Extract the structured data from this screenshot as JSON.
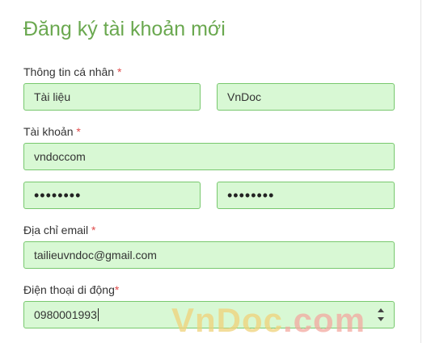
{
  "form": {
    "title": "Đăng ký tài khoản mới",
    "personal": {
      "label": "Thông tin cá nhân",
      "required_mark": "*",
      "first_name": "Tài liệu",
      "last_name": "VnDoc"
    },
    "account": {
      "label": "Tài khoản",
      "required_mark": "*",
      "username": "vndoccom",
      "password": "••••••••",
      "password_confirm": "••••••••"
    },
    "email": {
      "label": "Địa chỉ email",
      "required_mark": "*",
      "value": "tailieuvndoc@gmail.com"
    },
    "phone": {
      "label": "Điện thoại di động",
      "required_mark": "*",
      "value": "0980001993"
    }
  },
  "watermark": {
    "part1": "VnDoc",
    "part2": ".com"
  },
  "colors": {
    "title": "#6aa84f",
    "field_bg": "#d8f8d4",
    "field_border": "#78c86e",
    "required": "#e04b4b"
  }
}
